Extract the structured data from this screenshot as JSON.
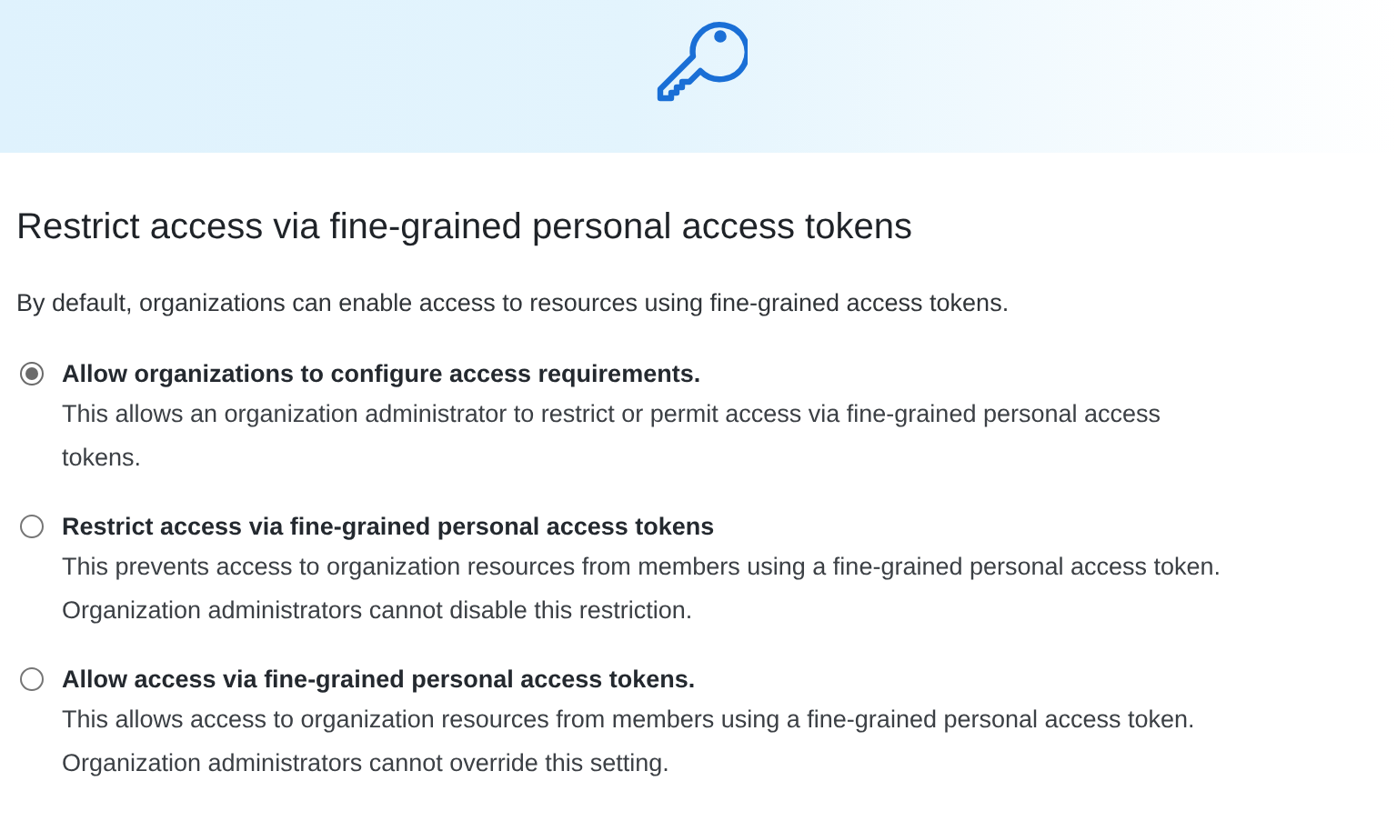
{
  "heading": "Restrict access via fine-grained personal access tokens",
  "intro": "By default, organizations can enable access to resources using fine-grained access tokens.",
  "options": [
    {
      "label": "Allow organizations to configure access requirements.",
      "selected": true,
      "lines": [
        "This allows an organization administrator to restrict or permit access via fine-grained personal access",
        "tokens."
      ]
    },
    {
      "label": "Restrict access via fine-grained personal access tokens",
      "selected": false,
      "lines": [
        "This prevents access to organization resources from members using a fine-grained personal access token.",
        "Organization administrators cannot disable this restriction."
      ]
    },
    {
      "label": "Allow access via fine-grained personal access tokens.",
      "selected": false,
      "lines": [
        "This allows access to organization resources from members using a fine-grained personal access token.",
        "Organization administrators cannot override this setting."
      ]
    }
  ]
}
